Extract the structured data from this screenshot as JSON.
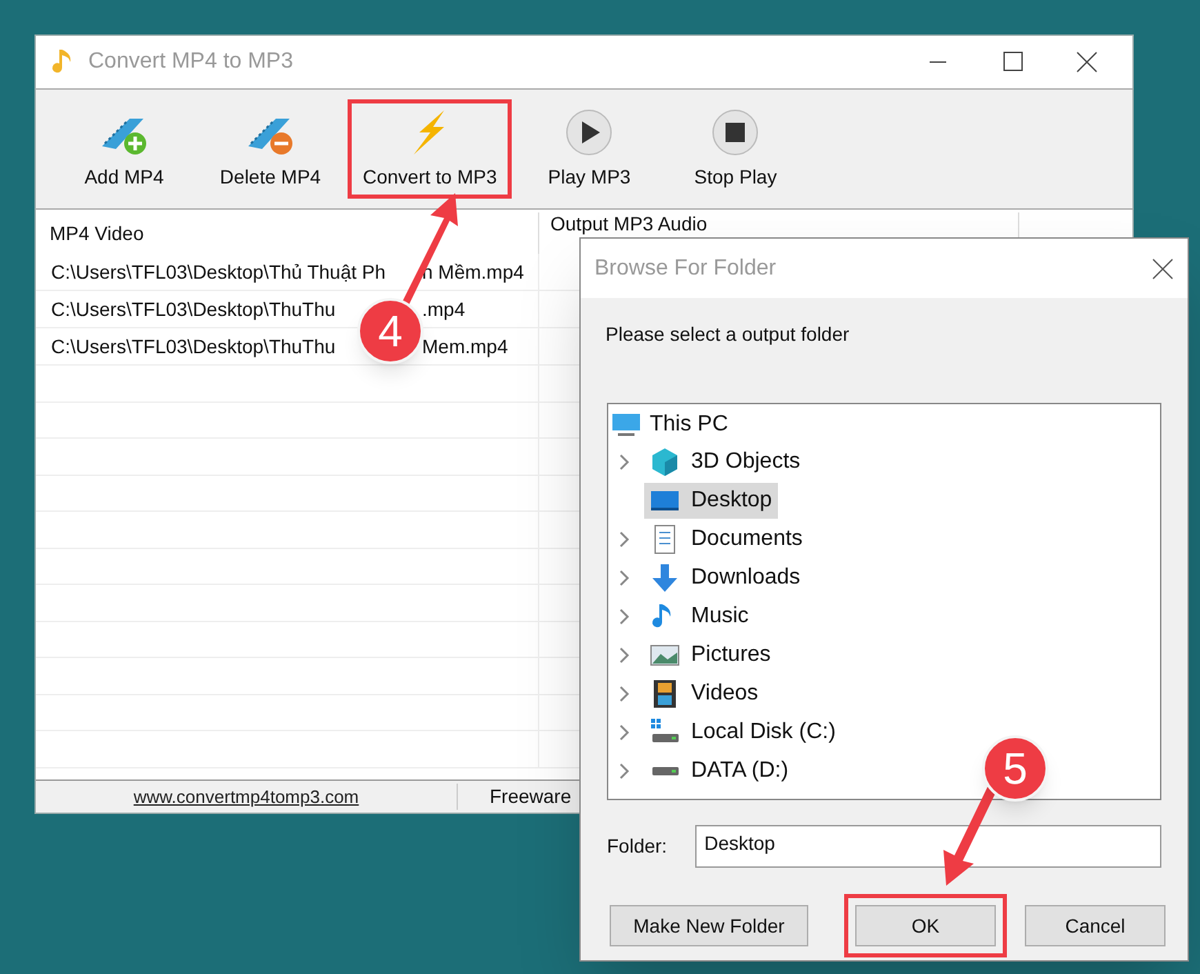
{
  "window": {
    "title": "Convert MP4 to MP3"
  },
  "toolbar": [
    {
      "label": "Add MP4",
      "kind": "add",
      "highlighted": false
    },
    {
      "label": "Delete MP4",
      "kind": "delete",
      "highlighted": false
    },
    {
      "label": "Convert to MP3",
      "kind": "convert",
      "highlighted": true
    },
    {
      "label": "Play MP3",
      "kind": "play",
      "highlighted": false
    },
    {
      "label": "Stop Play",
      "kind": "stop",
      "highlighted": false
    }
  ],
  "table": {
    "columns": [
      "MP4 Video",
      "Output MP3 Audio"
    ],
    "rows": [
      {
        "path": [
          "C:\\Users\\TFL03\\Desktop\\Thủ Thuật Ph",
          "n Mềm.mp4"
        ]
      },
      {
        "path": [
          "C:\\Users\\TFL03\\Desktop\\ThuThu",
          ".mp4"
        ]
      },
      {
        "path": [
          "C:\\Users\\TFL03\\Desktop\\ThuThu",
          "Mem.mp4"
        ]
      }
    ]
  },
  "status_bar": {
    "link": "www.convertmp4tomp3.com",
    "text": "Freeware"
  },
  "dialog": {
    "title": "Browse For Folder",
    "prompt": "Please select a output folder",
    "tree": {
      "label": "This PC",
      "children": [
        {
          "label": "3D Objects",
          "kind": "objects",
          "expandable": true,
          "selected": false
        },
        {
          "label": "Desktop",
          "kind": "desktop",
          "expandable": false,
          "selected": true
        },
        {
          "label": "Documents",
          "kind": "documents",
          "expandable": true,
          "selected": false
        },
        {
          "label": "Downloads",
          "kind": "downloads",
          "expandable": true,
          "selected": false
        },
        {
          "label": "Music",
          "kind": "music",
          "expandable": true,
          "selected": false
        },
        {
          "label": "Pictures",
          "kind": "pictures",
          "expandable": true,
          "selected": false
        },
        {
          "label": "Videos",
          "kind": "videos",
          "expandable": true,
          "selected": false
        },
        {
          "label": "Local Disk (C:)",
          "kind": "disk_c",
          "expandable": true,
          "selected": false
        },
        {
          "label": "DATA (D:)",
          "kind": "disk_d",
          "expandable": true,
          "selected": false
        }
      ]
    },
    "folder_label": "Folder:",
    "folder_value": "Desktop",
    "buttons": [
      {
        "label": "Make New Folder",
        "highlighted": false
      },
      {
        "label": "OK",
        "highlighted": true
      },
      {
        "label": "Cancel",
        "highlighted": false
      }
    ]
  },
  "callouts": [
    {
      "number": "4"
    },
    {
      "number": "5"
    }
  ]
}
